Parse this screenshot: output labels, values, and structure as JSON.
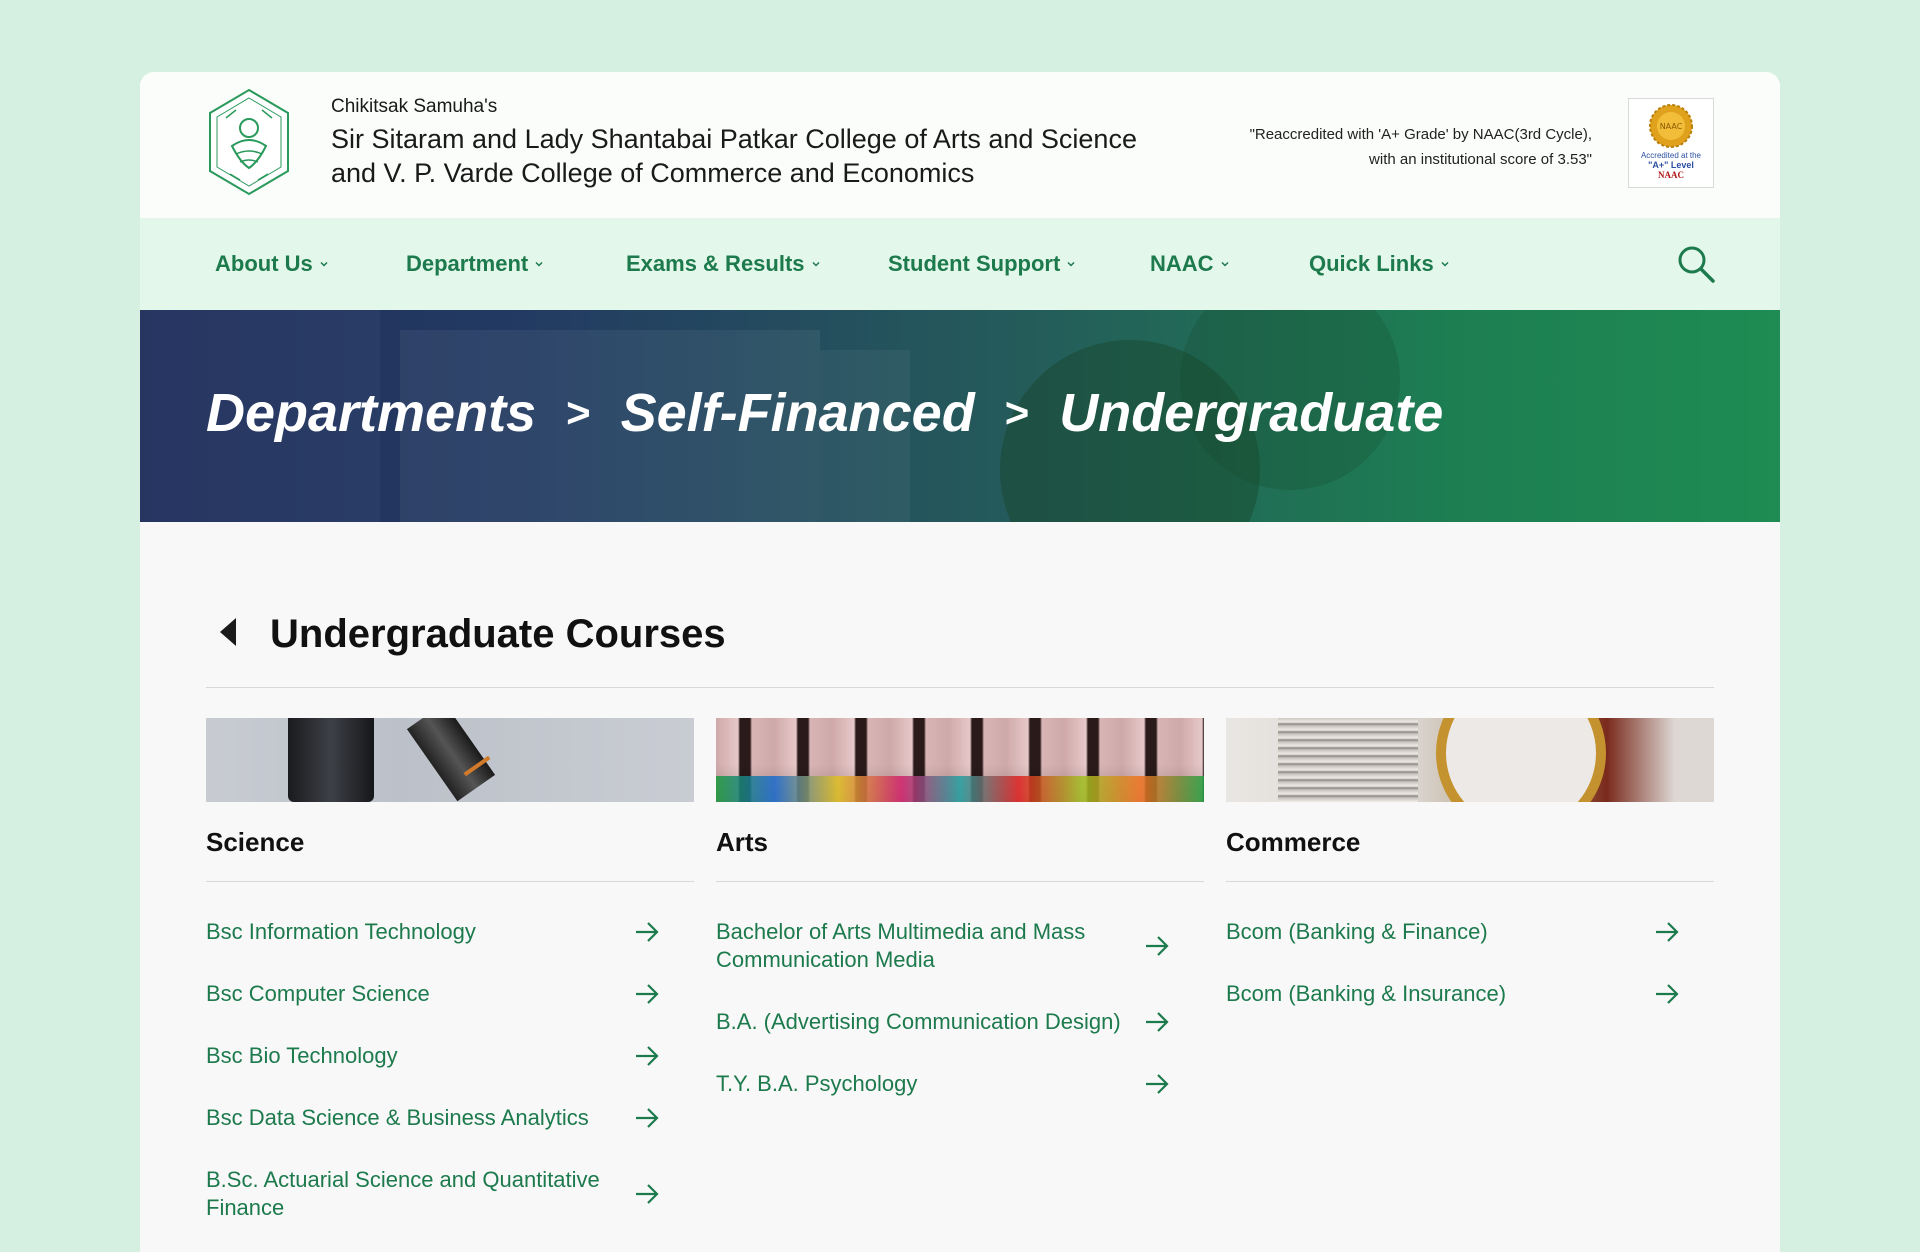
{
  "header": {
    "pre_title": "Chikitsak Samuha's",
    "college_line1": "Sir Sitaram and Lady Shantabai Patkar College of Arts and Science",
    "college_line2": "and V. P. Varde College of Commerce and Economics",
    "accreditation_line1": "\"Reaccredited with 'A+ Grade' by NAAC(3rd Cycle),",
    "accreditation_line2": "with an institutional score of 3.53\"",
    "badge": {
      "seal": "NAAC",
      "line1": "Accredited at the",
      "line2": "\"A+\" Level",
      "line3": "NAAC"
    },
    "logo_icon": "college-crest-icon"
  },
  "nav": {
    "items": [
      {
        "label": "About Us"
      },
      {
        "label": "Department"
      },
      {
        "label": "Exams & Results"
      },
      {
        "label": "Student Support"
      },
      {
        "label": "NAAC"
      },
      {
        "label": "Quick Links"
      }
    ],
    "search_icon": "search-icon"
  },
  "hero": {
    "crumb1": "Departments",
    "crumb2": "Self-Financed",
    "crumb3": "Undergraduate",
    "separator": ">"
  },
  "section": {
    "title": "Undergraduate Courses",
    "back_icon": "caret-left-icon"
  },
  "columns": [
    {
      "title": "Science",
      "courses": [
        "Bsc Information Technology",
        "Bsc Computer Science",
        "Bsc Bio Technology",
        "Bsc Data Science & Business Analytics",
        "B.Sc. Actuarial Science and Quantitative Finance"
      ]
    },
    {
      "title": "Arts",
      "courses": [
        "Bachelor of Arts Multimedia and Mass Communication Media",
        "B.A. (Advertising Communication Design)",
        "T.Y. B.A. Psychology"
      ]
    },
    {
      "title": "Commerce",
      "courses": [
        "Bcom (Banking & Finance)",
        "Bcom (Banking & Insurance)"
      ]
    }
  ],
  "colors": {
    "accent_green": "#1d7a4d",
    "nav_bg": "#e3f7ea",
    "page_bg": "#d5efe0"
  }
}
